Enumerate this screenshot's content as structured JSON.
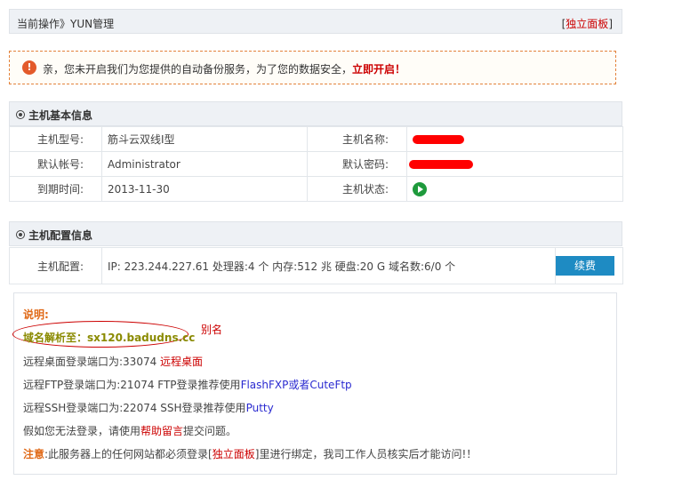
{
  "header": {
    "current_operation": "当前操作》YUN管理",
    "independent_panel_prefix": "[",
    "independent_panel": "独立面板",
    "independent_panel_suffix": "]"
  },
  "notice": {
    "icon": "exclamation-icon",
    "text": "亲，您未开启我们为您提供的自动备份服务，为了您的数据安全，",
    "link": "立即开启！"
  },
  "basic_info": {
    "title": "主机基本信息",
    "rows": [
      {
        "label1": "主机型号:",
        "value1": "筋斗云双线Ⅰ型",
        "label2": "主机名称:"
      },
      {
        "label1": "默认帐号:",
        "value1": "Administrator",
        "label2": "默认密码:"
      },
      {
        "label1": "到期时间:",
        "value1": "2013-11-30",
        "label2": "主机状态:"
      }
    ]
  },
  "config": {
    "title": "主机配置信息",
    "label": "主机配置:",
    "value": "IP: 223.244.227.61 处理器:4 个 内存:512 兆 硬盘:20 G 域名数:6/0 个",
    "renew_button": "续费"
  },
  "explain": {
    "title": "说明:",
    "domain_line": "域名解析至：sx120.badudns.cc",
    "alias_note": "别名",
    "rdp_text": "远程桌面登录端口为:33074 ",
    "rdp_link": "远程桌面",
    "ftp_text": "远程FTP登录端口为:21074 FTP登录推荐使用",
    "ftp_link": "FlashFXP或者CuteFtp",
    "ssh_text": "远程SSH登录端口为:22074 SSH登录推荐使用",
    "ssh_link": "Putty",
    "help_prefix": "假如您无法登录，请使用",
    "help_link": "帮助留言",
    "help_suffix": "提交问题。",
    "note_label": "注意",
    "note_text1": ":此服务器上的任何网站都必须登录[",
    "note_link": "独立面板",
    "note_text2": "]里进行绑定，我司工作人员核实后才能访问!！"
  }
}
